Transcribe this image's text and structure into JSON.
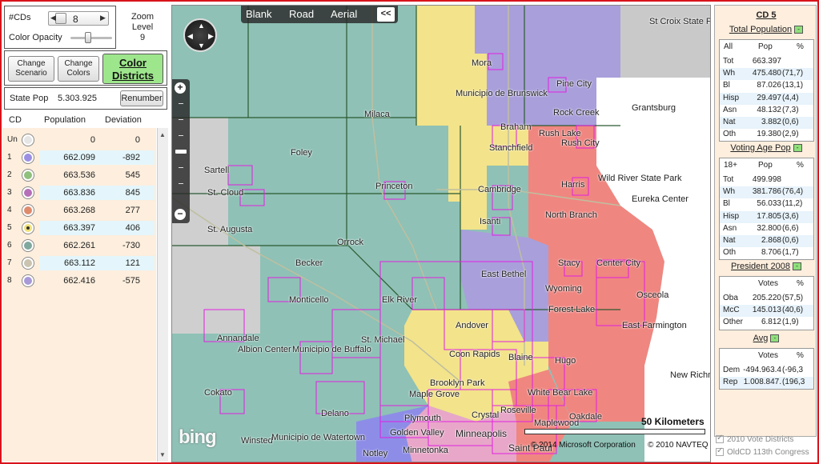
{
  "controls": {
    "cds_label": "#CDs",
    "cds_value": "8",
    "color_opacity_label": "Color Opacity",
    "color_opacity_level": 0.75,
    "zoom_label": "Zoom Level",
    "zoom_value": "9",
    "change_scenario": "Change Scenario",
    "change_colors": "Change Colors",
    "color_districts": "Color Districts",
    "state_pop_label": "State Pop",
    "state_pop_value": "5.303.925",
    "renumber": "Renumber"
  },
  "district_table": {
    "headers": {
      "cd": "CD",
      "population": "Population",
      "deviation": "Deviation"
    },
    "rows": [
      {
        "cd": "Un",
        "color": "#e6e6e6",
        "population": "0",
        "deviation": "0",
        "selected": false,
        "highlight": false
      },
      {
        "cd": "1",
        "color": "#9b8fe4",
        "population": "662.099",
        "deviation": "-892",
        "selected": false,
        "highlight": true
      },
      {
        "cd": "2",
        "color": "#8fc07c",
        "population": "663.536",
        "deviation": "545",
        "selected": false,
        "highlight": false
      },
      {
        "cd": "3",
        "color": "#b56fb8",
        "population": "663.836",
        "deviation": "845",
        "selected": false,
        "highlight": true
      },
      {
        "cd": "4",
        "color": "#e08a6c",
        "population": "663.268",
        "deviation": "277",
        "selected": false,
        "highlight": false
      },
      {
        "cd": "5",
        "color": "#f0e078",
        "population": "663.397",
        "deviation": "406",
        "selected": true,
        "highlight": true
      },
      {
        "cd": "6",
        "color": "#7fa89e",
        "population": "662.261",
        "deviation": "-730",
        "selected": false,
        "highlight": false
      },
      {
        "cd": "7",
        "color": "#c9c3b0",
        "population": "663.112",
        "deviation": "121",
        "selected": false,
        "highlight": true
      },
      {
        "cd": "8",
        "color": "#a89ad8",
        "population": "662.416",
        "deviation": "-575",
        "selected": false,
        "highlight": false
      }
    ]
  },
  "map": {
    "view_buttons": [
      "Blank",
      "Road",
      "Aerial"
    ],
    "collapse_label": "<<",
    "scale_label": "50 Kilometers",
    "copyright_ms": "© 2014 Microsoft Corporation",
    "copyright_navteq": "© 2010 NAVTEQ",
    "logo": "bing",
    "places": [
      "St Croix State Park",
      "Mora",
      "Pine City",
      "Grantsburg",
      "Municipio de Brunswick",
      "Rock Creek",
      "Milaca",
      "Braham",
      "Rush Lake",
      "Rush City",
      "Foley",
      "Stanchfield",
      "Wild River State Park",
      "Sartell",
      "St. Cloud",
      "Princeton",
      "Cambridge",
      "Harris",
      "Eureka Center",
      "Isanti",
      "North Branch",
      "St. Augusta",
      "Orrock",
      "Becker",
      "Stacy",
      "Center City",
      "East Bethel",
      "Wyoming",
      "Osceola",
      "Monticello",
      "Elk River",
      "Forest Lake",
      "Annandale",
      "Andover",
      "East Farmington",
      "St. Michael",
      "Albion Center",
      "Municipio de Buffalo",
      "Coon Rapids",
      "Blaine",
      "Hugo",
      "New Richm",
      "Brooklyn Park",
      "Cokato",
      "Maple Grove",
      "White Bear Lake",
      "Roseville",
      "Delano",
      "Plymouth",
      "Crystal",
      "Maplewood",
      "Oakdale",
      "Golden Valley",
      "Minneapolis",
      "Winsted",
      "Municipio de Watertown",
      "Minnetonka",
      "Saint Paul",
      "Notley"
    ]
  },
  "right_panel": {
    "cd_title": "CD 5",
    "total_population": {
      "title": "Total Population",
      "toggle": "-",
      "headers": [
        "All",
        "Pop",
        "%"
      ],
      "rows": [
        [
          "Tot",
          "663.397",
          ""
        ],
        [
          "Wh",
          "475.480",
          "(71,7)"
        ],
        [
          "Bl",
          "87.026",
          "(13,1)"
        ],
        [
          "Hisp",
          "29.497",
          "(4,4)"
        ],
        [
          "Asn",
          "48.132",
          "(7,3)"
        ],
        [
          "Nat",
          "3.882",
          "(0,6)"
        ],
        [
          "Oth",
          "19.380",
          "(2,9)"
        ]
      ]
    },
    "voting_age_pop": {
      "title": "Voting Age Pop",
      "toggle": "-",
      "headers": [
        "18+",
        "Pop",
        "%"
      ],
      "rows": [
        [
          "Tot",
          "499.998",
          ""
        ],
        [
          "Wh",
          "381.786",
          "(76,4)"
        ],
        [
          "Bl",
          "56.033",
          "(11,2)"
        ],
        [
          "Hisp",
          "17.805",
          "(3,6)"
        ],
        [
          "Asn",
          "32.800",
          "(6,6)"
        ],
        [
          "Nat",
          "2.868",
          "(0,6)"
        ],
        [
          "Oth",
          "8.706",
          "(1,7)"
        ]
      ]
    },
    "president_2008": {
      "title": "President 2008",
      "toggle": "-",
      "headers": [
        "",
        "Votes",
        "%"
      ],
      "rows": [
        [
          "Oba",
          "205.220",
          "(57,5)"
        ],
        [
          "McC",
          "145.013",
          "(40,6)"
        ],
        [
          "Other",
          "6.812",
          "(1,9)"
        ]
      ]
    },
    "avg": {
      "title": "Avg",
      "toggle": "-",
      "headers": [
        "",
        "Votes",
        "%"
      ],
      "rows": [
        [
          "Dem",
          "-494.963.4",
          "(-96,3"
        ],
        [
          "Rep",
          "1.008.847.",
          "(196,3"
        ]
      ]
    }
  },
  "checkboxes": {
    "vote_districts": "2010 Vote Districts",
    "old_cd": "OldCD 113th Congress"
  },
  "colors": {
    "frame": "#d8131b",
    "teal_district": "#7fa89e",
    "yellow_district": "#f3e38a",
    "purple_district": "#a99fdb",
    "red_district": "#f08680",
    "precinct_magenta": "#e020e0",
    "toggle_green": "#8fe07a"
  }
}
